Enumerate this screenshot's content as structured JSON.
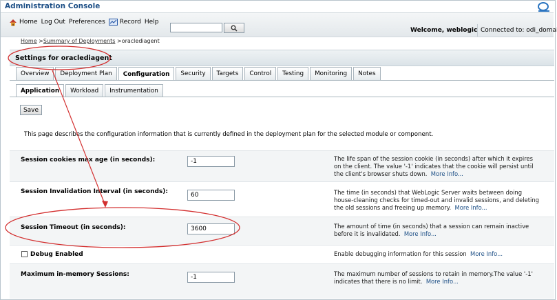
{
  "app_title": "Administration Console",
  "toolbar": {
    "home_label": "Home",
    "logout_label": "Log Out",
    "preferences_label": "Preferences",
    "record_label": "Record",
    "help_label": "Help",
    "search_value": "",
    "welcome_text": "Welcome, weblogic",
    "connected_text": "Connected to: odi_domain"
  },
  "breadcrumb": {
    "home": "Home",
    "sep1": " >",
    "summary": "Summary of Deployments",
    "sep2": " >",
    "current": "oraclediagent"
  },
  "settings_title": "Settings for oraclediagent",
  "tabs": [
    "Overview",
    "Deployment Plan",
    "Configuration",
    "Security",
    "Targets",
    "Control",
    "Testing",
    "Monitoring",
    "Notes"
  ],
  "active_tab": "Configuration",
  "subtabs": [
    "Application",
    "Workload",
    "Instrumentation"
  ],
  "active_subtab": "Application",
  "save_label": "Save",
  "description": "This page describes the configuration information that is currently defined in the deployment plan for the selected module or component.",
  "fields": {
    "cookies_max_age": {
      "label": "Session cookies max age (in seconds):",
      "value": "-1",
      "help": "The life span of the session cookie (in seconds) after which it expires on the client. The value '-1' indicates that the cookie will persist until the client's browser shuts down.",
      "more": "More Info..."
    },
    "invalidation_interval": {
      "label": "Session Invalidation Interval (in seconds):",
      "value": "60",
      "help": "The time (in seconds) that WebLogic Server waits between doing house-cleaning checks for timed-out and invalid sessions, and deleting the old sessions and freeing up memory.",
      "more": "More Info..."
    },
    "session_timeout": {
      "label": "Session Timeout (in seconds):",
      "value": "3600",
      "help": "The amount of time (in seconds) that a session can remain inactive before it is invalidated.",
      "more": "More Info..."
    },
    "debug_enabled": {
      "label": "Debug Enabled",
      "checked": false,
      "help": "Enable debugging information for this session",
      "more": "More Info..."
    },
    "max_sessions": {
      "label": "Maximum in-memory Sessions:",
      "value": "-1",
      "help": "The maximum number of sessions to retain in memory.The value '-1' indicates that there is no limit.",
      "more": "More Info..."
    }
  },
  "colors": {
    "annotation": "#d32f2f",
    "brand": "#1d4f86",
    "link": "#1d4f86"
  }
}
